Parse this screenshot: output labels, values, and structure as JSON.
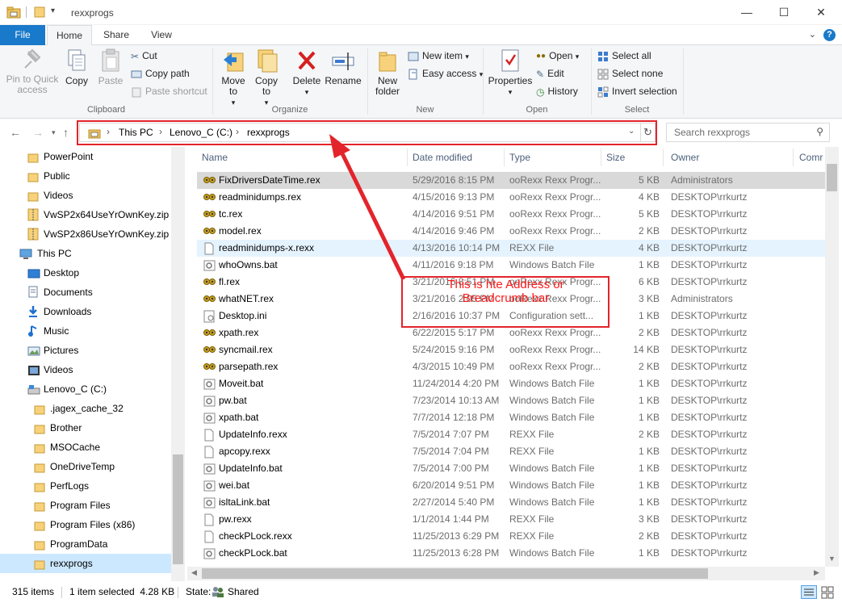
{
  "window": {
    "title": "rexxprogs",
    "controls": {
      "minimize": "—",
      "maximize": "☐",
      "close": "✕"
    }
  },
  "ribbon_tabs": {
    "file": "File",
    "home": "Home",
    "share": "Share",
    "view": "View",
    "help": "?"
  },
  "ribbon": {
    "clipboard": {
      "label": "Clipboard",
      "pin": "Pin to Quick access",
      "copy": "Copy",
      "paste": "Paste",
      "cut": "Cut",
      "copy_path": "Copy path",
      "paste_shortcut": "Paste shortcut"
    },
    "organize": {
      "label": "Organize",
      "move_to": "Move to",
      "copy_to": "Copy to",
      "delete": "Delete",
      "rename": "Rename"
    },
    "new": {
      "label": "New",
      "new_folder": "New folder",
      "new_item": "New item",
      "easy_access": "Easy access"
    },
    "open": {
      "label": "Open",
      "properties": "Properties",
      "open": "Open",
      "edit": "Edit",
      "history": "History"
    },
    "select": {
      "label": "Select",
      "select_all": "Select all",
      "select_none": "Select none",
      "invert": "Invert selection"
    }
  },
  "address": {
    "crumbs": [
      "This PC",
      "Lenovo_C (C:)",
      "rexxprogs"
    ],
    "search_placeholder": "Search rexxprogs"
  },
  "nav_items": [
    {
      "label": "PowerPoint",
      "icon": "folder-icon"
    },
    {
      "label": "Public",
      "icon": "folder-icon"
    },
    {
      "label": "Videos",
      "icon": "folder-icon"
    },
    {
      "label": "VwSP2x64UseYrOwnKey.zip",
      "icon": "zip-icon"
    },
    {
      "label": "VwSP2x86UseYrOwnKey.zip",
      "icon": "zip-icon"
    },
    {
      "label": "This PC",
      "icon": "computer-icon"
    },
    {
      "label": "Desktop",
      "icon": "desktop-icon"
    },
    {
      "label": "Documents",
      "icon": "documents-icon"
    },
    {
      "label": "Downloads",
      "icon": "downloads-icon"
    },
    {
      "label": "Music",
      "icon": "music-icon"
    },
    {
      "label": "Pictures",
      "icon": "pictures-icon"
    },
    {
      "label": "Videos",
      "icon": "videos-icon"
    },
    {
      "label": "Lenovo_C (C:)",
      "icon": "drive-icon"
    },
    {
      "label": ".jagex_cache_32",
      "icon": "folder-icon"
    },
    {
      "label": "Brother",
      "icon": "folder-icon"
    },
    {
      "label": "MSOCache",
      "icon": "folder-icon"
    },
    {
      "label": "OneDriveTemp",
      "icon": "folder-icon"
    },
    {
      "label": "PerfLogs",
      "icon": "folder-icon"
    },
    {
      "label": "Program Files",
      "icon": "folder-icon"
    },
    {
      "label": "Program Files (x86)",
      "icon": "folder-icon"
    },
    {
      "label": "ProgramData",
      "icon": "folder-icon"
    },
    {
      "label": "rexxprogs",
      "icon": "folder-icon"
    }
  ],
  "columns": [
    "Name",
    "Date modified",
    "Type",
    "Size",
    "Owner",
    "Comr"
  ],
  "files": [
    {
      "name": "FixDriversDateTime.rex",
      "date": "5/29/2016 8:15 PM",
      "type": "ooRexx Rexx Progr...",
      "size": "5 KB",
      "owner": "Administrators",
      "icon": "rexx-icon"
    },
    {
      "name": "readminidumps.rex",
      "date": "4/15/2016 9:13 PM",
      "type": "ooRexx Rexx Progr...",
      "size": "4 KB",
      "owner": "DESKTOP\\rrkurtz",
      "icon": "rexx-icon"
    },
    {
      "name": "tc.rex",
      "date": "4/14/2016 9:51 PM",
      "type": "ooRexx Rexx Progr...",
      "size": "5 KB",
      "owner": "DESKTOP\\rrkurtz",
      "icon": "rexx-icon"
    },
    {
      "name": "model.rex",
      "date": "4/14/2016 9:46 PM",
      "type": "ooRexx Rexx Progr...",
      "size": "2 KB",
      "owner": "DESKTOP\\rrkurtz",
      "icon": "rexx-icon"
    },
    {
      "name": "readminidumps-x.rexx",
      "date": "4/13/2016 10:14 PM",
      "type": "REXX File",
      "size": "4 KB",
      "owner": "DESKTOP\\rrkurtz",
      "icon": "file-icon"
    },
    {
      "name": "whoOwns.bat",
      "date": "4/11/2016 9:18 PM",
      "type": "Windows Batch File",
      "size": "1 KB",
      "owner": "DESKTOP\\rrkurtz",
      "icon": "batch-icon"
    },
    {
      "name": "fl.rex",
      "date": "3/21/2016 8:51 PM",
      "type": "ooRexx Rexx Progr...",
      "size": "6 KB",
      "owner": "DESKTOP\\rrkurtz",
      "icon": "rexx-icon"
    },
    {
      "name": "whatNET.rex",
      "date": "3/21/2016 2:05 PM",
      "type": "ooRexx Rexx Progr...",
      "size": "3 KB",
      "owner": "Administrators",
      "icon": "rexx-icon"
    },
    {
      "name": "Desktop.ini",
      "date": "2/16/2016 10:37 PM",
      "type": "Configuration sett...",
      "size": "1 KB",
      "owner": "DESKTOP\\rrkurtz",
      "icon": "config-icon"
    },
    {
      "name": "xpath.rex",
      "date": "6/22/2015 5:17 PM",
      "type": "ooRexx Rexx Progr...",
      "size": "2 KB",
      "owner": "DESKTOP\\rrkurtz",
      "icon": "rexx-icon"
    },
    {
      "name": "syncmail.rex",
      "date": "5/24/2015 9:16 PM",
      "type": "ooRexx Rexx Progr...",
      "size": "14 KB",
      "owner": "DESKTOP\\rrkurtz",
      "icon": "rexx-icon"
    },
    {
      "name": "parsepath.rex",
      "date": "4/3/2015 10:49 PM",
      "type": "ooRexx Rexx Progr...",
      "size": "2 KB",
      "owner": "DESKTOP\\rrkurtz",
      "icon": "rexx-icon"
    },
    {
      "name": "Moveit.bat",
      "date": "11/24/2014 4:20 PM",
      "type": "Windows Batch File",
      "size": "1 KB",
      "owner": "DESKTOP\\rrkurtz",
      "icon": "batch-icon"
    },
    {
      "name": "pw.bat",
      "date": "7/23/2014 10:13 AM",
      "type": "Windows Batch File",
      "size": "1 KB",
      "owner": "DESKTOP\\rrkurtz",
      "icon": "batch-icon"
    },
    {
      "name": "xpath.bat",
      "date": "7/7/2014 12:18 PM",
      "type": "Windows Batch File",
      "size": "1 KB",
      "owner": "DESKTOP\\rrkurtz",
      "icon": "batch-icon"
    },
    {
      "name": "UpdateInfo.rexx",
      "date": "7/5/2014 7:07 PM",
      "type": "REXX File",
      "size": "2 KB",
      "owner": "DESKTOP\\rrkurtz",
      "icon": "file-icon"
    },
    {
      "name": "apcopy.rexx",
      "date": "7/5/2014 7:04 PM",
      "type": "REXX File",
      "size": "1 KB",
      "owner": "DESKTOP\\rrkurtz",
      "icon": "file-icon"
    },
    {
      "name": "UpdateInfo.bat",
      "date": "7/5/2014 7:00 PM",
      "type": "Windows Batch File",
      "size": "1 KB",
      "owner": "DESKTOP\\rrkurtz",
      "icon": "batch-icon"
    },
    {
      "name": "wei.bat",
      "date": "6/20/2014 9:51 PM",
      "type": "Windows Batch File",
      "size": "1 KB",
      "owner": "DESKTOP\\rrkurtz",
      "icon": "batch-icon"
    },
    {
      "name": "isltaLink.bat",
      "date": "2/27/2014 5:40 PM",
      "type": "Windows Batch File",
      "size": "1 KB",
      "owner": "DESKTOP\\rrkurtz",
      "icon": "batch-icon"
    },
    {
      "name": "pw.rexx",
      "date": "1/1/2014 1:44 PM",
      "type": "REXX File",
      "size": "3 KB",
      "owner": "DESKTOP\\rrkurtz",
      "icon": "file-icon"
    },
    {
      "name": "checkPLock.rexx",
      "date": "11/25/2013 6:29 PM",
      "type": "REXX File",
      "size": "2 KB",
      "owner": "DESKTOP\\rrkurtz",
      "icon": "file-icon"
    },
    {
      "name": "checkPLock.bat",
      "date": "11/25/2013 6:28 PM",
      "type": "Windows Batch File",
      "size": "1 KB",
      "owner": "DESKTOP\\rrkurtz",
      "icon": "batch-icon"
    }
  ],
  "status": {
    "items": "315 items",
    "selected": "1 item selected  4.28 KB",
    "state_label": "State:",
    "state_value": "Shared"
  },
  "annotation": {
    "line1": "This is hte Address or",
    "line2": "Breadcrumb bar",
    "color": "#e3242b"
  }
}
